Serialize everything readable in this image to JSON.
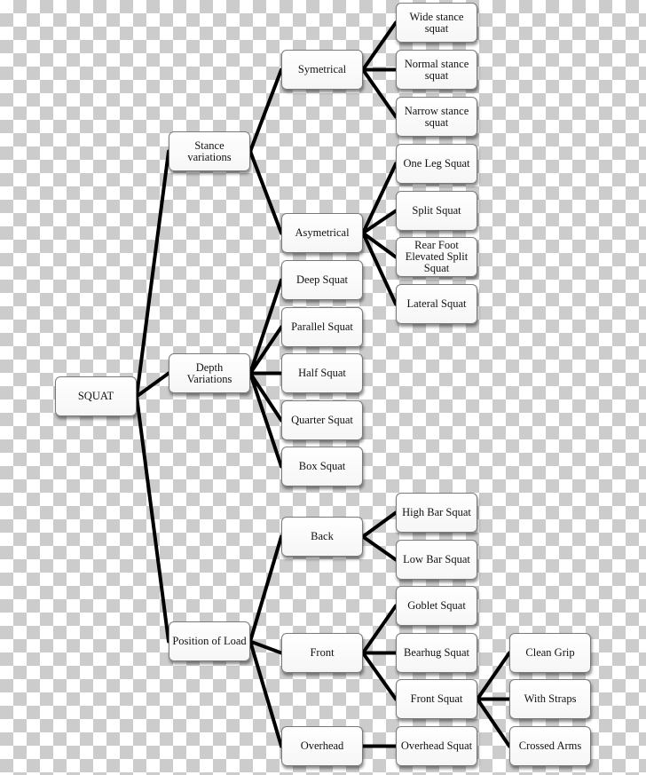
{
  "diagram": {
    "title": "SQUAT",
    "colors": {
      "line": "#000000",
      "node_fill": "#ffffff",
      "node_border": "#7a7a7a",
      "background_checker": "#cccccc"
    },
    "nodes": {
      "root": "SQUAT",
      "stance": "Stance\nvariations",
      "depth": "Depth\nVariations",
      "load": "Position of Load",
      "symetrical": "Symetrical",
      "asymetrical": "Asymetrical",
      "wide": "Wide stance\nsquat",
      "normal": "Normal stance\nsquat",
      "narrow": "Narrow stance\nsquat",
      "oneleg": "One Leg Squat",
      "split": "Split Squat",
      "rearfoot": "Rear Foot\nElevated Split\nSquat",
      "lateral": "Lateral Squat",
      "deep": "Deep Squat",
      "parallel": "Parallel Squat",
      "half": "Half Squat",
      "quarter": "Quarter Squat",
      "box": "Box Squat",
      "back": "Back",
      "front": "Front",
      "overhead": "Overhead",
      "highbar": "High Bar Squat",
      "lowbar": "Low Bar Squat",
      "goblet": "Goblet Squat",
      "bearhug": "Bearhug Squat",
      "frontsquat": "Front Squat",
      "overheadsquat": "Overhead Squat",
      "cleangrip": "Clean Grip",
      "straps": "With Straps",
      "crossed": "Crossed Arms"
    },
    "edges": [
      [
        "root",
        "stance"
      ],
      [
        "root",
        "depth"
      ],
      [
        "root",
        "load"
      ],
      [
        "stance",
        "symetrical"
      ],
      [
        "stance",
        "asymetrical"
      ],
      [
        "symetrical",
        "wide"
      ],
      [
        "symetrical",
        "normal"
      ],
      [
        "symetrical",
        "narrow"
      ],
      [
        "asymetrical",
        "oneleg"
      ],
      [
        "asymetrical",
        "split"
      ],
      [
        "asymetrical",
        "rearfoot"
      ],
      [
        "asymetrical",
        "lateral"
      ],
      [
        "depth",
        "deep"
      ],
      [
        "depth",
        "parallel"
      ],
      [
        "depth",
        "half"
      ],
      [
        "depth",
        "quarter"
      ],
      [
        "depth",
        "box"
      ],
      [
        "load",
        "back"
      ],
      [
        "load",
        "front"
      ],
      [
        "load",
        "overhead"
      ],
      [
        "back",
        "highbar"
      ],
      [
        "back",
        "lowbar"
      ],
      [
        "front",
        "goblet"
      ],
      [
        "front",
        "bearhug"
      ],
      [
        "front",
        "frontsquat"
      ],
      [
        "frontsquat",
        "cleangrip"
      ],
      [
        "frontsquat",
        "straps"
      ],
      [
        "frontsquat",
        "crossed"
      ],
      [
        "overhead",
        "overheadsquat"
      ]
    ]
  }
}
